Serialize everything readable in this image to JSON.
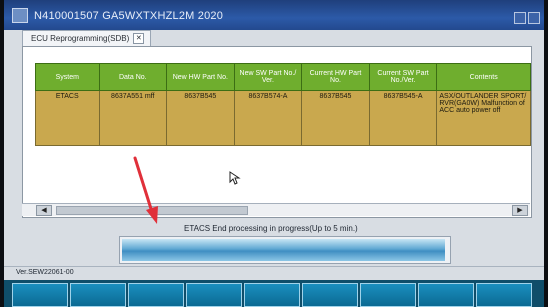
{
  "window": {
    "title": "N410001507   GA5WXTXHZL2M 2020"
  },
  "tab": {
    "label": "ECU Reprogramming(SDB)",
    "close_glyph": "✕"
  },
  "table": {
    "headers": [
      "System",
      "Data No.",
      "New HW Part No.",
      "New SW Part No./ Ver.",
      "Current HW Part No.",
      "Current SW Part No./Ver.",
      "Contents"
    ],
    "rows": [
      [
        "ETACS",
        "8637A551 mff",
        "8637B545",
        "8637B574-A",
        "8637B545",
        "8637B545-A",
        "ASX/OUTLANDER SPORT/ RVR(GA0W)  Malfunction of ACC auto power off"
      ]
    ]
  },
  "scroll": {
    "left": "◀",
    "right": "▶"
  },
  "status": {
    "text": "ETACS End processing in progress(Up to 5 min.)"
  },
  "progress": {
    "value_pct": 99
  },
  "footer": {
    "version": "Ver.SEW22061-00"
  },
  "colors": {
    "header_green": "#6fae2e",
    "row_tan": "#c9a84e",
    "progress_blue": "#3f8ec2",
    "bottom_bar": "#0f4e6a"
  }
}
